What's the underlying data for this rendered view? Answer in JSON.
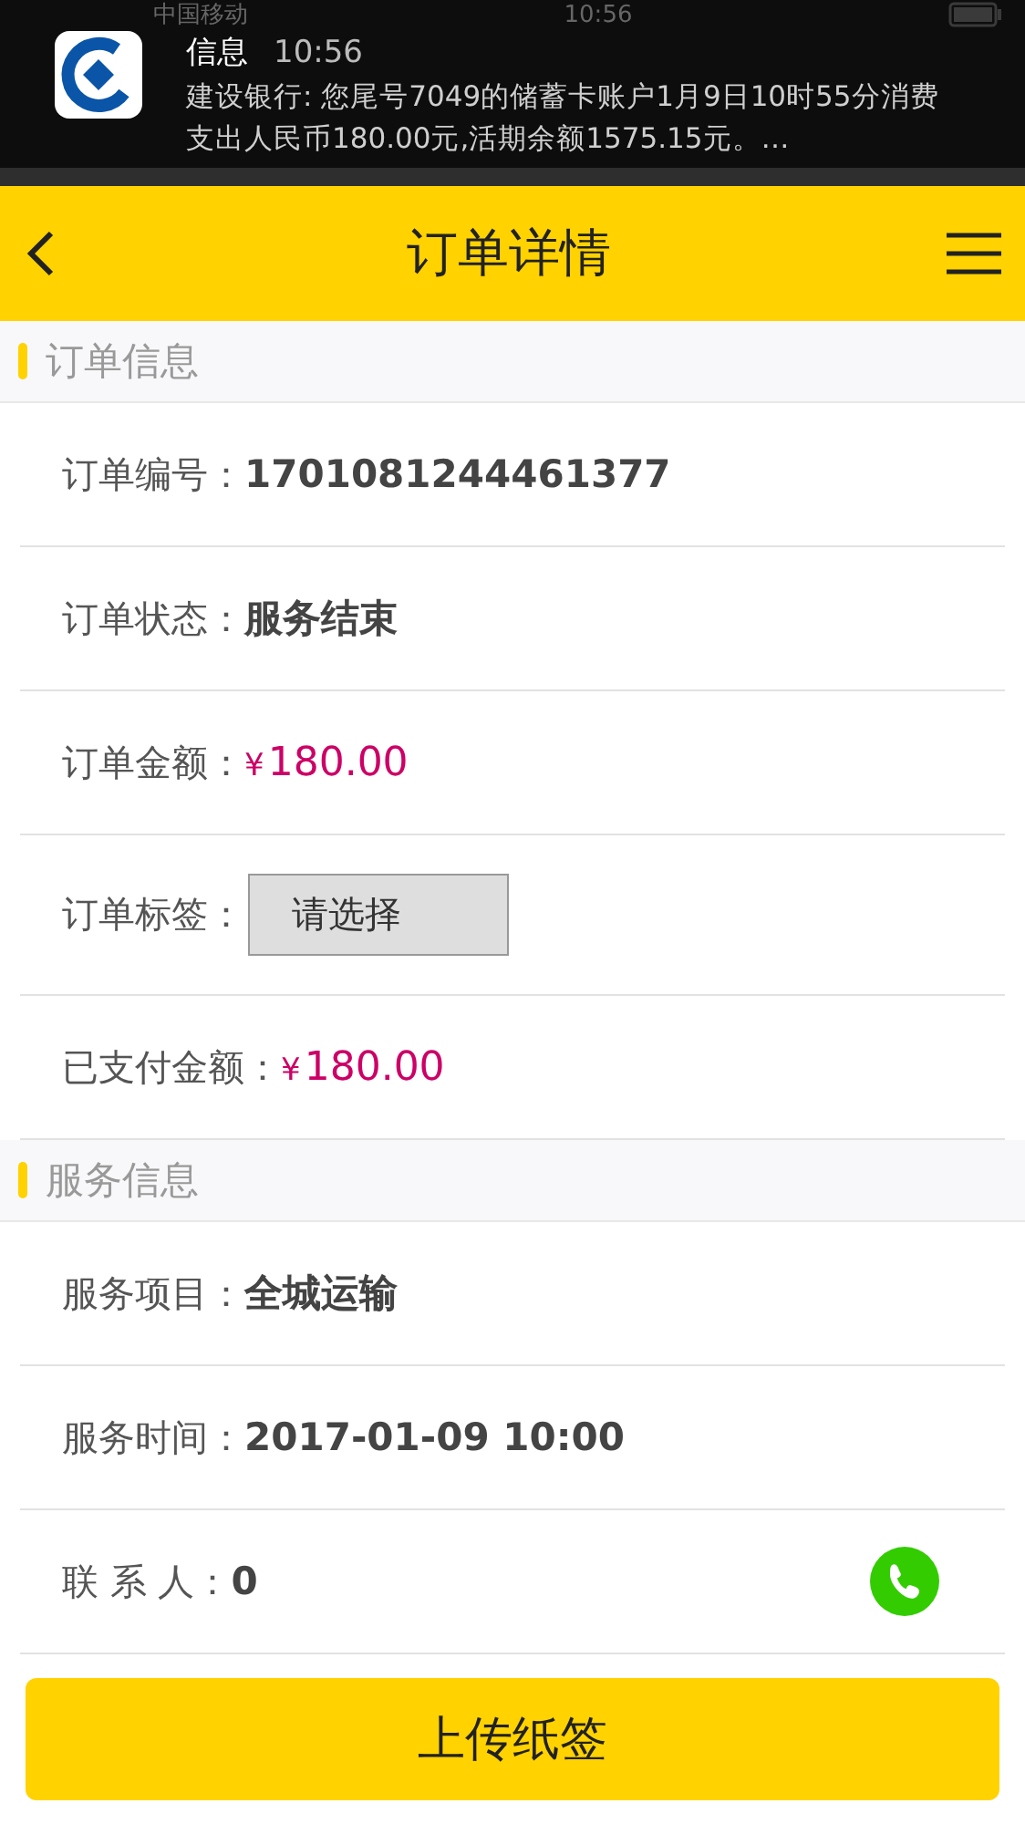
{
  "status_bar": {
    "carrier": "中国移动",
    "time": "10:56"
  },
  "notification": {
    "app": "信息",
    "time": "10:56",
    "message": "建设银行: 您尾号7049的储蓄卡账户1月9日10时55分消费支出人民币180.00元,活期余额1575.15元。…"
  },
  "header": {
    "title": "订单详情"
  },
  "sections": [
    {
      "title": "订单信息",
      "rows": [
        {
          "kind": "text",
          "label": "订单编号：",
          "value": "1701081244461377"
        },
        {
          "kind": "text",
          "label": "订单状态：",
          "value": "服务结束"
        },
        {
          "kind": "amount",
          "label": "订单金额：",
          "currency": "¥",
          "value": "180.00"
        },
        {
          "kind": "select",
          "label": "订单标签：",
          "value": "请选择"
        },
        {
          "kind": "amount",
          "label": "已支付金额：",
          "currency": "¥",
          "value": "180.00"
        }
      ]
    },
    {
      "title": "服务信息",
      "rows": [
        {
          "kind": "text",
          "label": "服务项目：",
          "value": "全城运输"
        },
        {
          "kind": "text",
          "label": "服务时间：",
          "value": "2017-01-09 10:00"
        },
        {
          "kind": "contact",
          "label": "联 系 人：",
          "value": "0"
        }
      ]
    }
  ],
  "footer_button": "上传纸签"
}
